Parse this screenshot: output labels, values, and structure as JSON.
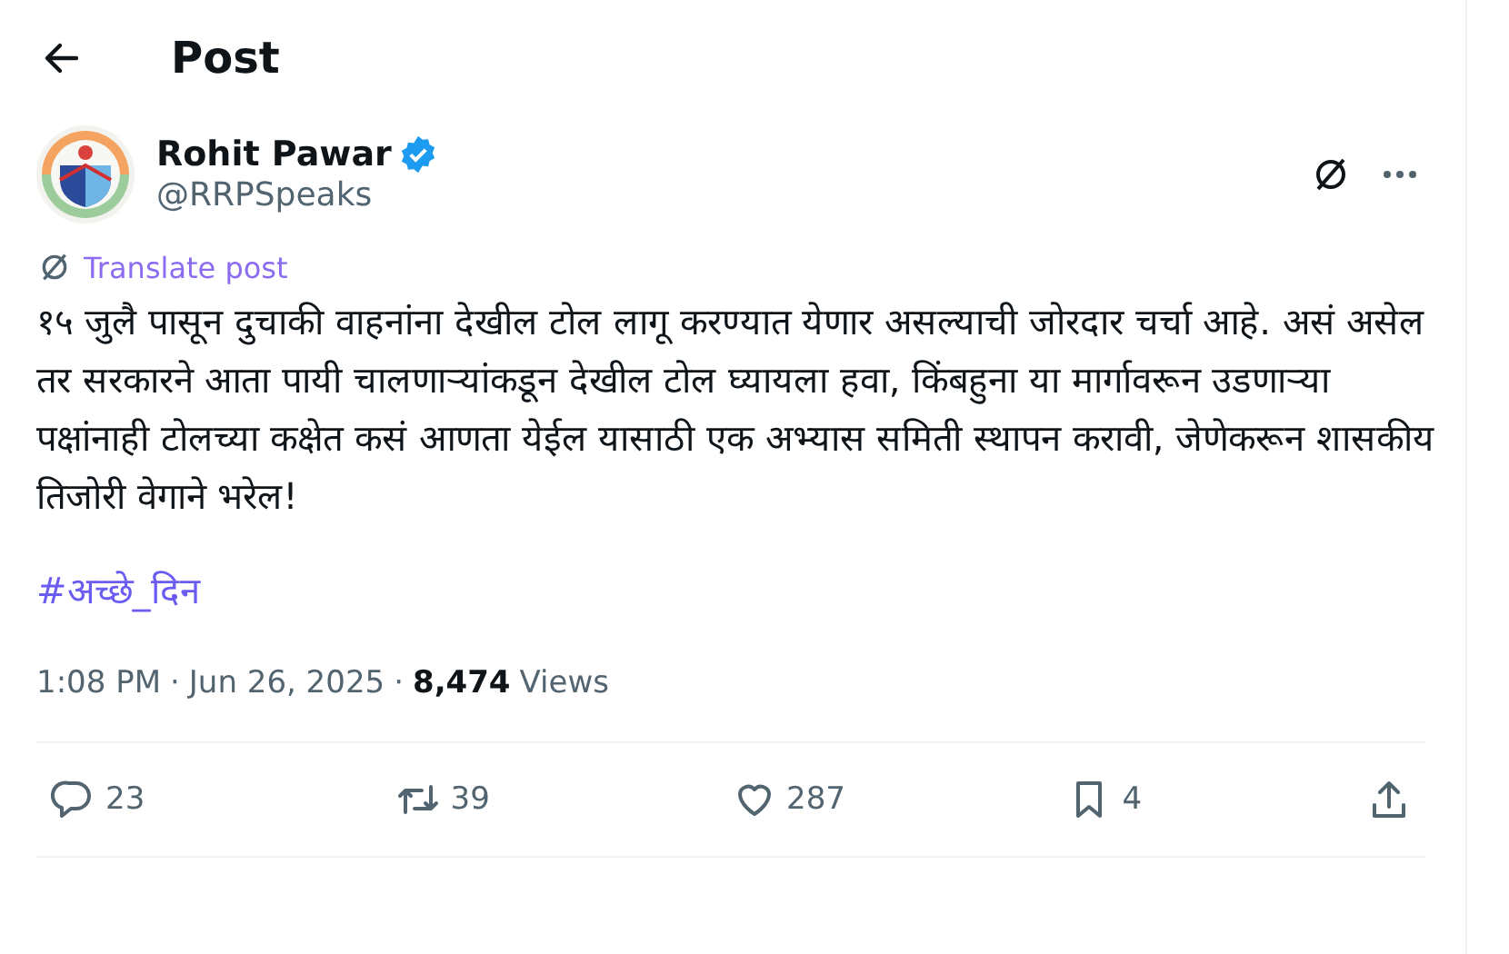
{
  "header": {
    "title": "Post"
  },
  "author": {
    "name": "Rohit Pawar",
    "verified": true,
    "handle": "@RRPSpeaks"
  },
  "translate": "Translate post",
  "text": "१५ जुलै पासून दुचाकी वाहनांना देखील टोल लागू करण्यात येणार असल्याची जोरदार चर्चा आहे. असं असेल तर सरकारने आता पायी चालणाऱ्यांकडून देखील टोल घ्यायला हवा, किंबहुना या मार्गावरून उडणाऱ्या पक्षांनाही टोलच्या कक्षेत कसं आणता येईल यासाठी एक अभ्यास समिती स्थापन करावी, जेणेकरून शासकीय तिजोरी वेगाने भरेल!",
  "hashtag": "#अच्छे_दिन",
  "meta": [
    {
      "kind": "plain",
      "text": "1:08 PM"
    },
    {
      "kind": "dot",
      "text": "·"
    },
    {
      "kind": "plain",
      "text": "Jun 26, 2025"
    },
    {
      "kind": "dot",
      "text": "·"
    },
    {
      "kind": "strong",
      "text": "8,474"
    },
    {
      "kind": "plain",
      "text": "Views"
    }
  ],
  "actions": [
    {
      "kind": "reply",
      "count": "23"
    },
    {
      "kind": "repost",
      "count": "39"
    },
    {
      "kind": "like",
      "count": "287"
    },
    {
      "kind": "bookmark",
      "count": "4"
    },
    {
      "kind": "share"
    }
  ]
}
